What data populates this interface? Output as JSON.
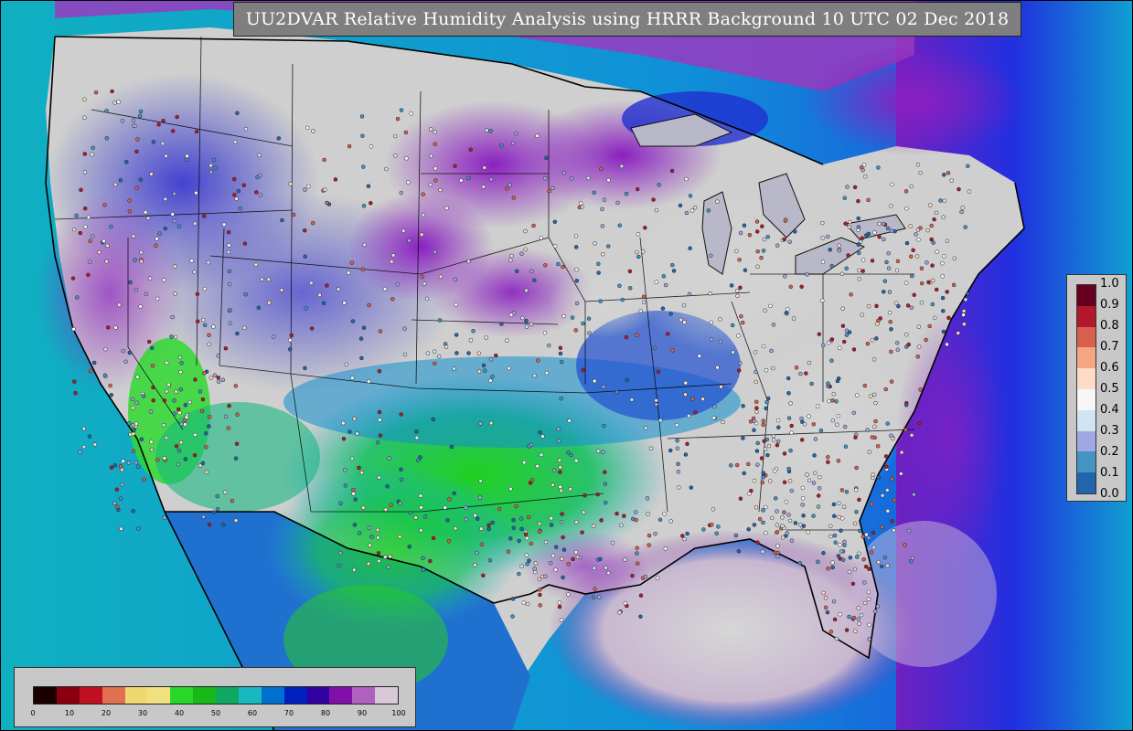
{
  "title": "UU2DVAR Relative Humidity Analysis using HRRR Background 10 UTC 02 Dec 2018",
  "obs_legend": {
    "labels": [
      "1.0",
      "0.9",
      "0.8",
      "0.7",
      "0.6",
      "0.5",
      "0.4",
      "0.3",
      "0.2",
      "0.1",
      "0.0"
    ],
    "colors": [
      "#67001f",
      "#b2182b",
      "#d6604d",
      "#f4a582",
      "#fddbc7",
      "#f7f7f7",
      "#d1e5f0",
      "#9fa8e0",
      "#4393c3",
      "#2166ac",
      "#053061"
    ]
  },
  "rh_legend": {
    "ticks": [
      "0",
      "10",
      "20",
      "30",
      "40",
      "50",
      "60",
      "70",
      "80",
      "90",
      "100"
    ],
    "colors": [
      "#1a0000",
      "#8a0010",
      "#c01020",
      "#e07050",
      "#f0d870",
      "#f0e080",
      "#28d828",
      "#18b818",
      "#10a860",
      "#18b8c0",
      "#0070d0",
      "#0020c0",
      "#3000a0",
      "#8010a8",
      "#b060c0",
      "#d8c8d8"
    ]
  }
}
